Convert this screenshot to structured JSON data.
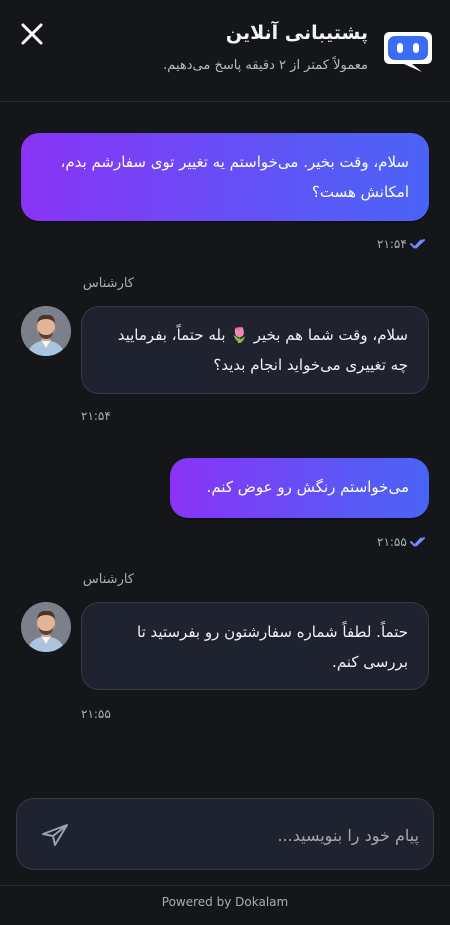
{
  "header": {
    "title": "پشتیبانی آنلاین",
    "subtitle": "معمولاً کمتر از ۲ دقیقه پاسخ می‌دهیم.",
    "close_icon": "close-icon",
    "logo_icon": "chat-bot-icon"
  },
  "messages": [
    {
      "role": "user",
      "text": "سلام، وقت بخیر. می‌خواستم یه تغییر توی سفارشم بدم، امکانش هست؟",
      "time": "۲۱:۵۴",
      "status": "read"
    },
    {
      "role": "agent",
      "sender": "کارشناس",
      "text": "سلام، وقت شما هم بخیر 🌷 بله حتماً، بفرمایید چه تغییری می‌خواید انجام بدید؟",
      "time": "۲۱:۵۴"
    },
    {
      "role": "user",
      "text": "می‌خواستم رنگش رو عوض کنم.",
      "time": "۲۱:۵۵",
      "status": "read"
    },
    {
      "role": "agent",
      "sender": "کارشناس",
      "text": "حتماً. لطفاً شماره سفارشتون رو بفرستید تا بررسی کنم.",
      "time": "۲۱:۵۵"
    }
  ],
  "composer": {
    "placeholder": "پیام خود را بنویسید...",
    "send_icon": "send-icon"
  },
  "footer": {
    "text": "Powered by Dokalam"
  },
  "colors": {
    "background": "#15161a",
    "user_bubble_start": "#4b63f7",
    "user_bubble_end": "#8a33f6",
    "agent_bubble": "#1f2330",
    "check": "#6f8cff",
    "logo": "#3b6cf6"
  }
}
